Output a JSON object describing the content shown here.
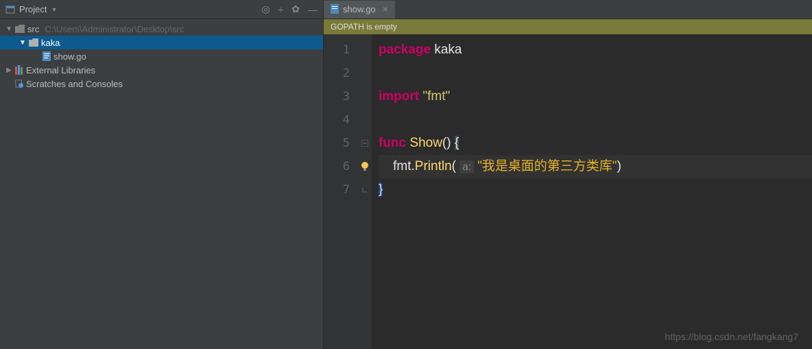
{
  "sidebar": {
    "title": "Project",
    "tree": {
      "root": {
        "label": "src",
        "path": "C:\\Users\\Administrator\\Desktop\\src"
      },
      "folder": {
        "label": "kaka"
      },
      "file": {
        "label": "show.go"
      },
      "external": {
        "label": "External Libraries"
      },
      "scratches": {
        "label": "Scratches and Consoles"
      }
    }
  },
  "tab": {
    "filename": "show.go"
  },
  "warning": "GOPATH is empty",
  "code": {
    "lines": [
      "1",
      "2",
      "3",
      "4",
      "5",
      "6",
      "7"
    ],
    "tokens": {
      "package": "package",
      "pkg_name": "kaka",
      "import": "import",
      "import_path": "\"fmt\"",
      "func": "func",
      "func_name": "Show",
      "parens": "()",
      "open_brace": "{",
      "fmt_call": "fmt.",
      "println": "Println",
      "open_paren": "(",
      "hint": "a:",
      "string": "\"我是桌面的第三方类库\"",
      "close_paren": ")",
      "close_brace": "}"
    }
  },
  "watermark": "https://blog.csdn.net/fangkang7"
}
